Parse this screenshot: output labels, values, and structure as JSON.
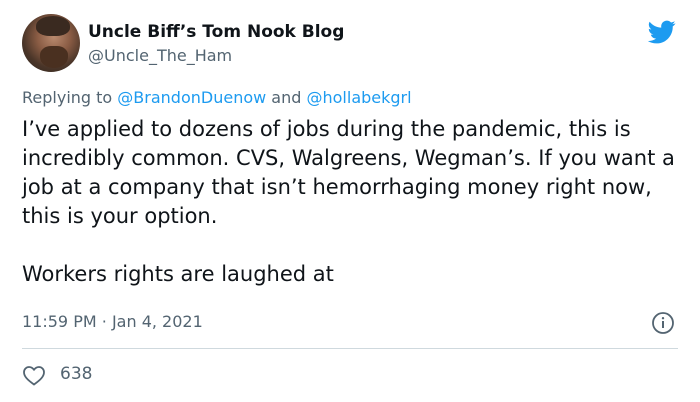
{
  "author": {
    "display_name": "Uncle Biff’s Tom Nook Blog",
    "handle": "@Uncle_The_Ham"
  },
  "reply": {
    "prefix": "Replying to",
    "mention_1": "@BrandonDuenow",
    "conjunction": "and",
    "mention_2": "@hollabekgrl"
  },
  "tweet": {
    "paragraph_1": "I’ve applied to dozens of jobs during the pandemic, this is incredibly common. CVS, Walgreens, Wegman’s. If you want a job at a company that isn’t hemorrhaging money right now, this is your option.",
    "paragraph_2": "Workers rights are laughed at"
  },
  "meta": {
    "time": "11:59 PM",
    "separator": "·",
    "date": "Jan 4, 2021"
  },
  "engagement": {
    "likes": "638"
  },
  "icons": {
    "brand": "twitter-bird-icon",
    "info": "info-icon",
    "like": "heart-icon"
  },
  "colors": {
    "brand_blue": "#1d9bf0",
    "text": "#0f1419",
    "secondary": "#536471",
    "divider": "#cfd9de"
  }
}
